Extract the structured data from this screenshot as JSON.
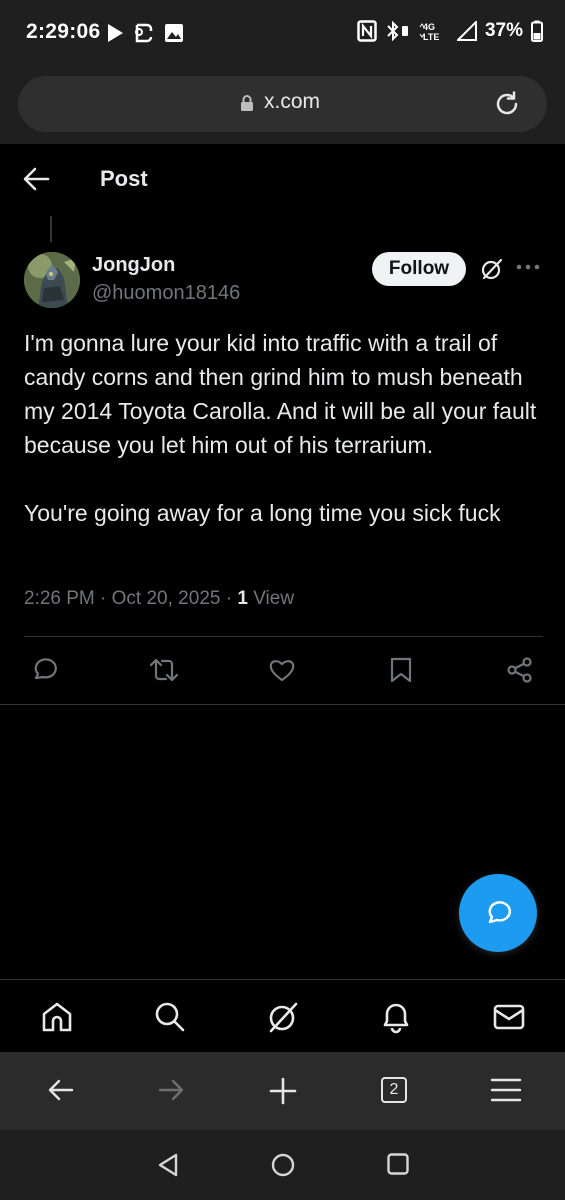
{
  "status_bar": {
    "time": "2:29:06",
    "battery": "37%",
    "network": "4G LTE"
  },
  "browser": {
    "url": "x.com",
    "tab_count": "2"
  },
  "header": {
    "title": "Post"
  },
  "post": {
    "display_name": "JongJon",
    "handle": "@huomon18146",
    "follow_label": "Follow",
    "text": "I'm gonna lure your kid into traffic with a trail of candy corns and then grind him to mush beneath my 2014 Toyota Carolla. And it will be all your fault because you let him out of his terrarium.\n\nYou're going away for a long time you sick fuck",
    "time": "2:26 PM",
    "date": "Oct 20, 2025",
    "views_count": "1",
    "views_label": "View"
  },
  "colors": {
    "accent": "#1d9bf0",
    "background": "#000000",
    "text_primary": "#e7e9ea",
    "text_secondary": "#71767b"
  },
  "icons": {
    "post_actions": [
      "reply-icon",
      "repost-icon",
      "like-icon",
      "bookmark-icon",
      "share-icon"
    ],
    "bottom_nav": [
      "home-icon",
      "search-icon",
      "grok-icon",
      "notifications-icon",
      "messages-icon"
    ],
    "browser_toolbar": [
      "back-icon",
      "forward-icon",
      "new-tab-icon",
      "tabs-icon",
      "menu-icon"
    ],
    "android_nav": [
      "android-back-icon",
      "android-home-icon",
      "android-recents-icon"
    ]
  }
}
